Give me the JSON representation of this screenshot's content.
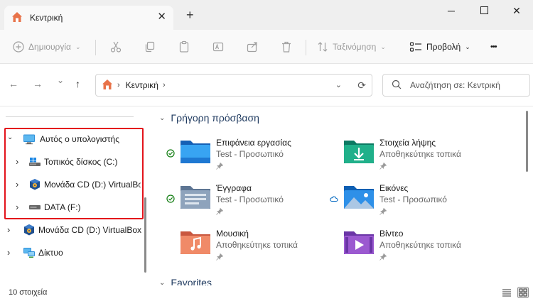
{
  "window": {
    "tab_title": "Κεντρική",
    "tab_close_glyph": "✕",
    "new_tab_glyph": "+",
    "minimize_glyph": "─",
    "close_glyph": "✕"
  },
  "toolbar": {
    "new_label": "Δημιουργία",
    "sort_label": "Ταξινόμηση",
    "view_label": "Προβολή",
    "more_glyph": "•••",
    "chevron_glyph": "⌄"
  },
  "address_bar": {
    "back_glyph": "←",
    "forward_glyph": "→",
    "recent_glyph": "⌄",
    "up_glyph": "↑",
    "separator_glyph": "›",
    "crumb": "Κεντρική",
    "dropdown_glyph": "⌄",
    "refresh_glyph": "⟳",
    "search_placeholder": "Αναζήτηση σε: Κεντρική"
  },
  "sidebar": {
    "items": [
      {
        "label": "Αυτός ο υπολογιστής",
        "expanded": true,
        "icon": "computer-icon"
      },
      {
        "label": "Τοπικός δίσκος (C:)",
        "expanded": false,
        "icon": "drive-c-icon"
      },
      {
        "label": "Μονάδα CD (D:) VirtualBox",
        "expanded": false,
        "icon": "cd-drive-icon"
      },
      {
        "label": "DATA (F:)",
        "expanded": false,
        "icon": "drive-icon"
      },
      {
        "label": "Μονάδα CD (D:) VirtualBox",
        "expanded": false,
        "icon": "cd-drive-icon"
      },
      {
        "label": "Δίκτυο",
        "expanded": false,
        "icon": "network-icon"
      }
    ],
    "expanded_glyph": "⌄",
    "collapsed_glyph": "›"
  },
  "main": {
    "quick_access": {
      "title": "Γρήγορη πρόσβαση",
      "items": [
        {
          "name": "Επιφάνεια εργασίας",
          "sub": "Test - Προσωπικό",
          "status": "synced"
        },
        {
          "name": "Στοιχεία λήψης",
          "sub": "Αποθηκεύτηκε τοπικά",
          "status": "none"
        },
        {
          "name": "Έγγραφα",
          "sub": "Test - Προσωπικό",
          "status": "synced"
        },
        {
          "name": "Εικόνες",
          "sub": "Test - Προσωπικό",
          "status": "cloud"
        },
        {
          "name": "Μουσική",
          "sub": "Αποθηκεύτηκε τοπικά",
          "status": "none"
        },
        {
          "name": "Βίντεο",
          "sub": "Αποθηκεύτηκε τοπικά",
          "status": "none"
        }
      ]
    },
    "favorites": {
      "title": "Favorites"
    }
  },
  "statusbar": {
    "count": "10 στοιχεία"
  },
  "colors": {
    "accent": "#0067c0",
    "highlight_border": "#e3131b",
    "status_green": "#107c10"
  }
}
